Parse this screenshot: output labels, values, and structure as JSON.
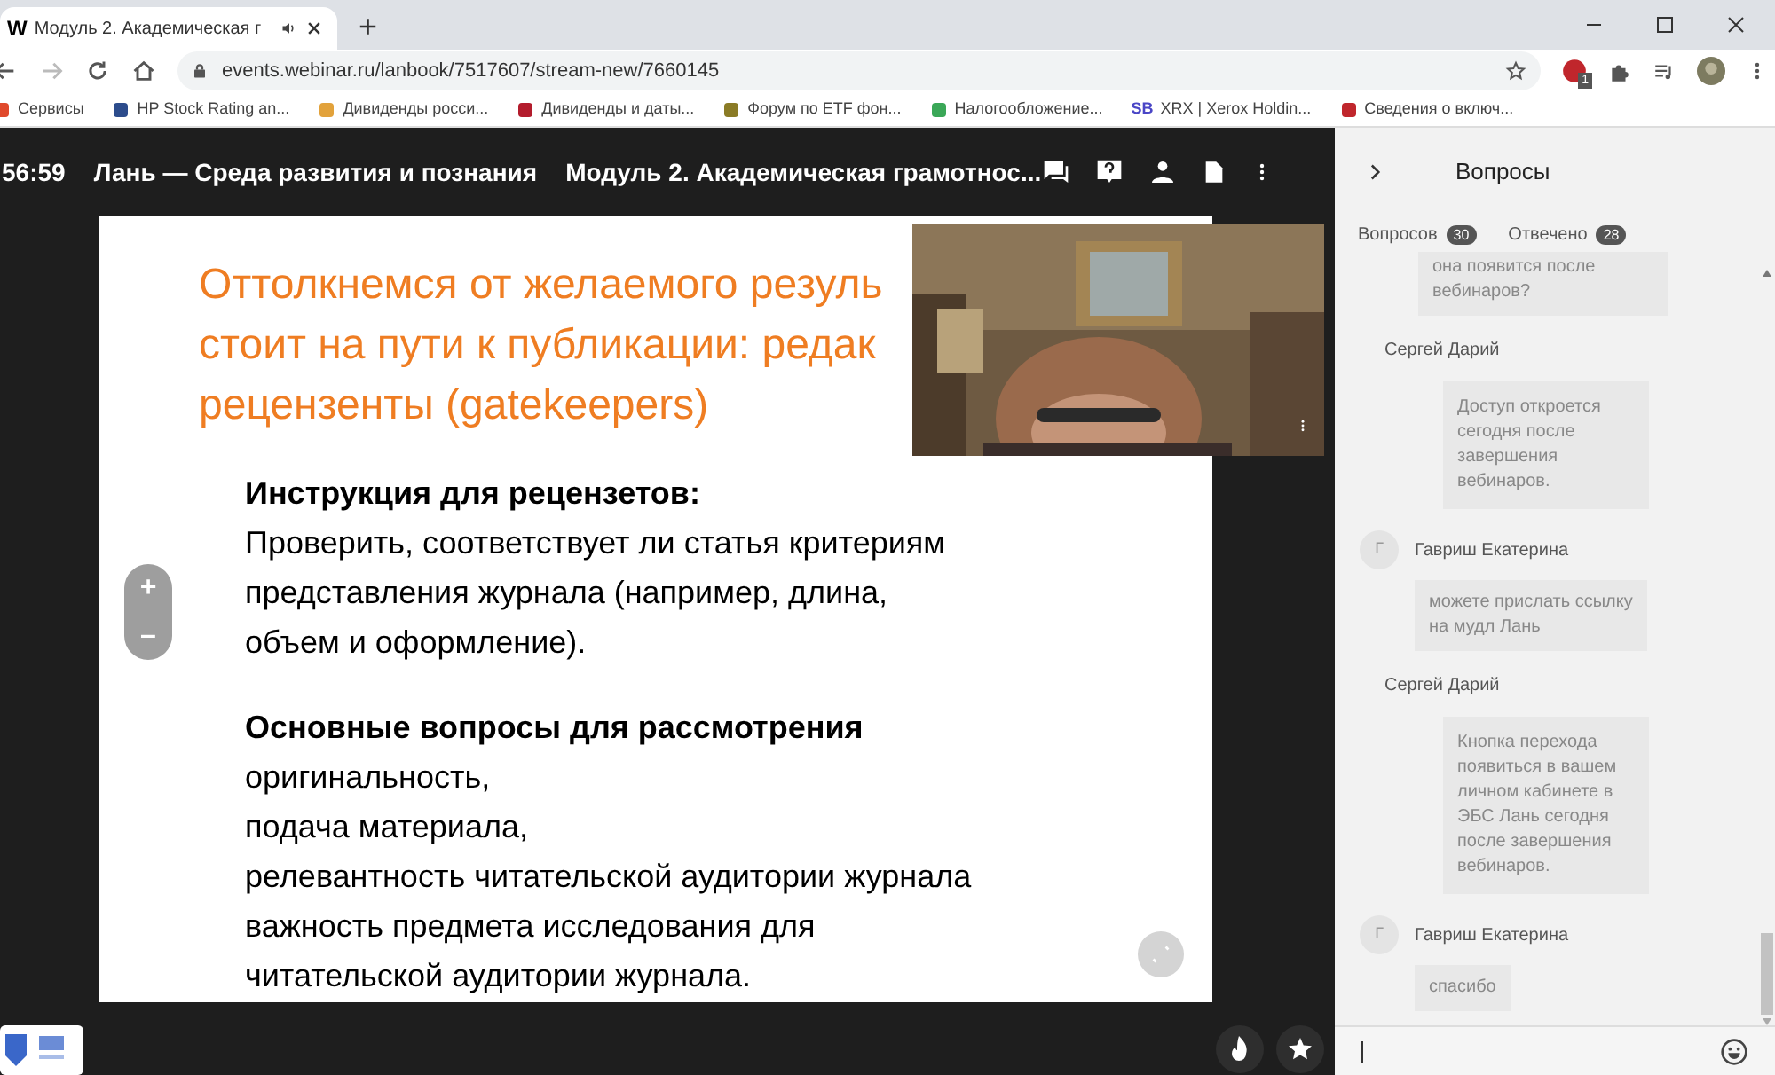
{
  "browser": {
    "site_logo": "W",
    "tab_title": "Модуль 2. Академическая г",
    "new_tab": "+",
    "url": "events.webinar.ru/lanbook/7517607/stream-new/7660145",
    "extension_badge": "1",
    "bookmarks": [
      {
        "label": "Сервисы"
      },
      {
        "label": "HP Stock Rating an..."
      },
      {
        "label": "Дивиденды росси..."
      },
      {
        "label": "Дивиденды и даты..."
      },
      {
        "label": "Форум по ETF фон..."
      },
      {
        "label": "Налогообложение..."
      },
      {
        "label": "XRX | Xerox Holdin...",
        "badge": "SB"
      },
      {
        "label": "Сведения о включ..."
      }
    ]
  },
  "header": {
    "timer": "56:59",
    "organizer": "Лань — Среда развития и познания",
    "event_title": "Модуль 2. Академическая грамотнос..."
  },
  "slide": {
    "title_lines": [
      "Оттолкнемся от желаемого резуль",
      "стоит на пути к публикации: редак",
      "рецензенты (gatekeepers)"
    ],
    "sections": [
      {
        "heading": "Инструкция для рецензетов:",
        "lines": [
          "Проверить, соответствует ли статья критериям",
          "представления журнала (например, длина,",
          "объем и оформление)."
        ]
      },
      {
        "heading": "Основные  вопросы для рассмотрения",
        "lines": [
          "оригинальность,",
          "подача материала,",
          "релевантность читательской аудитории журнала",
          "важность  предмета исследования для",
          "читательской аудитории журнала."
        ]
      }
    ],
    "zoom_in": "+",
    "zoom_out": "–"
  },
  "sidebar": {
    "title": "Вопросы",
    "tabs": [
      {
        "label": "Вопросов",
        "count": "30"
      },
      {
        "label": "Отвечено",
        "count": "28"
      }
    ],
    "messages": [
      {
        "kind": "answer",
        "text": "она появится после\nвебинаров?"
      },
      {
        "kind": "reply",
        "author": "Сергей Дарий",
        "text": "Доступ откроется\nсегодня после\nзавершения\nвебинаров."
      },
      {
        "kind": "question",
        "initial": "Г",
        "author": "Гавриш Екатерина",
        "text": "можете прислать ссылку\nна мудл Лань"
      },
      {
        "kind": "reply",
        "author": "Сергей Дарий",
        "text": "Кнопка перехода\nпоявиться в вашем\nличном кабинете в\nЭБС Лань сегодня\nпосле завершения\nвебинаров."
      },
      {
        "kind": "question",
        "initial": "Г",
        "author": "Гавриш Екатерина",
        "text": "спасибо"
      }
    ]
  }
}
